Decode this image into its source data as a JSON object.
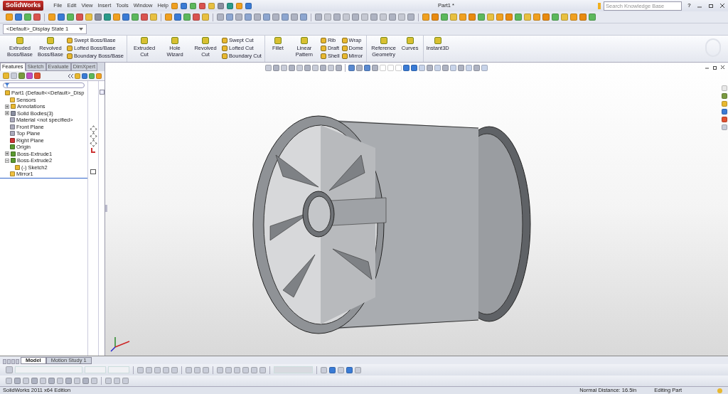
{
  "title_bar": {
    "app_name": "SolidWorks",
    "menus": [
      "File",
      "Edit",
      "View",
      "Insert",
      "Tools",
      "Window",
      "Help"
    ],
    "document_title": "Part1 *",
    "search": {
      "placeholder": "Search Knowledge Base"
    },
    "help": "?"
  },
  "configuration": {
    "value": "<Default>_Display State 1"
  },
  "command_manager": [
    [
      {
        "kind": "large",
        "label": "Extruded Boss/Base"
      },
      {
        "kind": "large",
        "label": "Revolved Boss/Base"
      },
      {
        "kind": "stack",
        "items": [
          "Swept Boss/Base",
          "Lofted Boss/Base",
          "Boundary Boss/Base"
        ]
      }
    ],
    [
      {
        "kind": "large",
        "label": "Extruded Cut"
      },
      {
        "kind": "large",
        "label": "Hole Wizard"
      },
      {
        "kind": "large",
        "label": "Revolved Cut"
      },
      {
        "kind": "stack",
        "items": [
          "Swept Cut",
          "Lofted Cut",
          "Boundary Cut"
        ]
      }
    ],
    [
      {
        "kind": "large",
        "label": "Fillet"
      },
      {
        "kind": "large",
        "label": "Linear Pattern"
      },
      {
        "kind": "stack",
        "items": [
          "Rib",
          "Draft",
          "Shell"
        ]
      },
      {
        "kind": "stack",
        "items": [
          "Wrap",
          "Dome",
          "Mirror"
        ]
      }
    ],
    [
      {
        "kind": "large",
        "label": "Reference Geometry"
      },
      {
        "kind": "large",
        "label": "Curves"
      }
    ],
    [
      {
        "kind": "large",
        "label": "Instant3D"
      }
    ]
  ],
  "panel_tabs": [
    {
      "label": "Features",
      "selected": true
    },
    {
      "label": "Sketch",
      "selected": false
    },
    {
      "label": "Evaluate",
      "selected": false
    },
    {
      "label": "DimXpert",
      "selected": false
    }
  ],
  "feature_tree": [
    {
      "label": "Part1  (Default<<Default>_Disp",
      "children": [
        {
          "label": "Sensors"
        },
        {
          "label": "Annotations",
          "expanded": false
        },
        {
          "label": "Solid Bodies(3)",
          "expanded": false
        },
        {
          "label": "Material <not specified>"
        },
        {
          "label": "Front Plane"
        },
        {
          "label": "Top Plane"
        },
        {
          "label": "Right Plane"
        },
        {
          "label": "Origin"
        },
        {
          "label": "Boss-Extrude1",
          "expanded": false
        },
        {
          "label": "Boss-Extrude2",
          "expanded": true,
          "children": [
            {
              "label": "(-) Sketch2"
            }
          ]
        },
        {
          "label": "Mirror1"
        }
      ]
    }
  ],
  "bottom_tabs": [
    {
      "label": "Model",
      "selected": true
    },
    {
      "label": "Motion Study 1",
      "selected": false
    }
  ],
  "status_bar": {
    "edition": "SolidWorks 2011 x64 Edition",
    "distance": "Normal Distance: 16.5in",
    "mode": "Editing Part"
  }
}
